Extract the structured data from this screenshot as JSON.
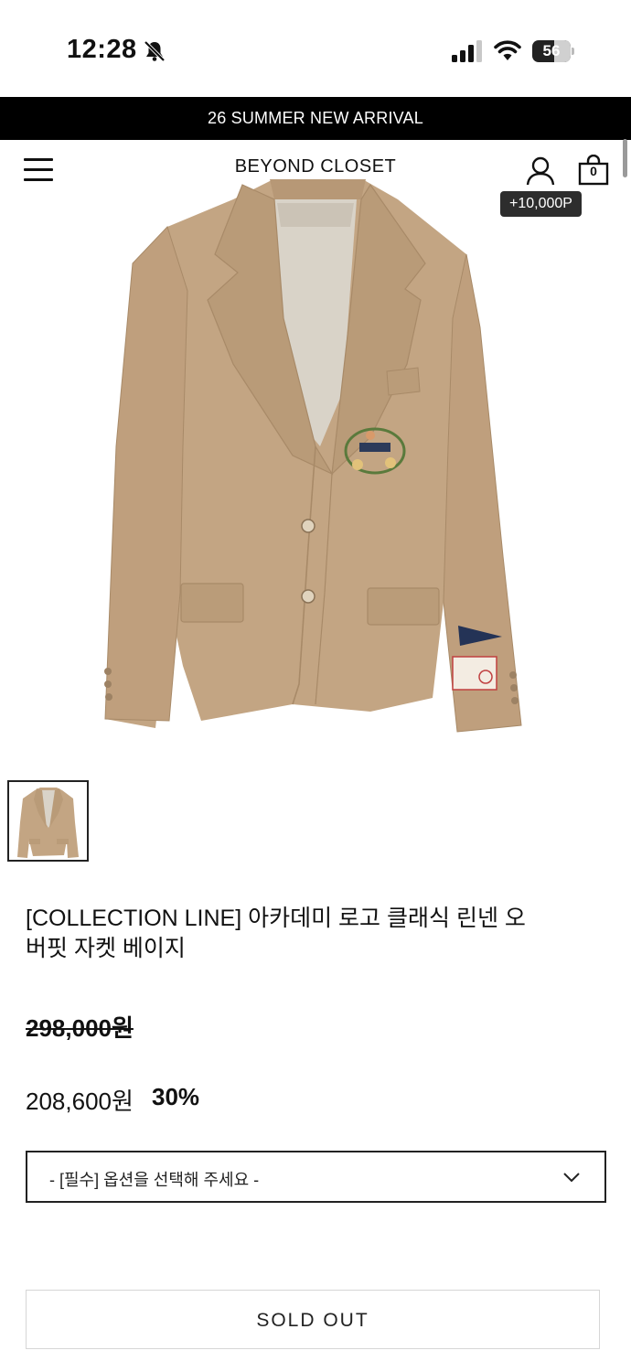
{
  "status_bar": {
    "time": "12:28",
    "battery": "56",
    "battery_level_percent": 56,
    "icons": [
      "bell-slash-icon",
      "cellular-signal-icon",
      "wifi-icon",
      "battery-icon"
    ]
  },
  "announcement": {
    "text": "26 SUMMER NEW ARRIVAL"
  },
  "header": {
    "brand": "BEYOND CLOSET",
    "cart_count": "0",
    "points_badge": "+10,000P",
    "icons": [
      "hamburger-menu-icon",
      "user-icon",
      "shopping-bag-icon"
    ]
  },
  "gallery": {
    "main_image": "beige linen oversized jacket product photo",
    "thumbnail_count": 1
  },
  "product": {
    "title_line1": "[COLLECTION LINE] 아카데미 로고 클래식 린넨 오",
    "title_line2": "버핏 자켓 베이지",
    "original_price": "298,000원",
    "sale_price": "208,600원",
    "discount": "30%"
  },
  "options": {
    "placeholder": "- [필수] 옵션을 선택해 주세요 -"
  },
  "actions": {
    "soldout_label": "SOLD OUT"
  },
  "colors": {
    "announce_bg": "#000000",
    "badge_bg": "#2d2d2d",
    "jacket_beige": "#c3a583",
    "text": "#111111"
  }
}
